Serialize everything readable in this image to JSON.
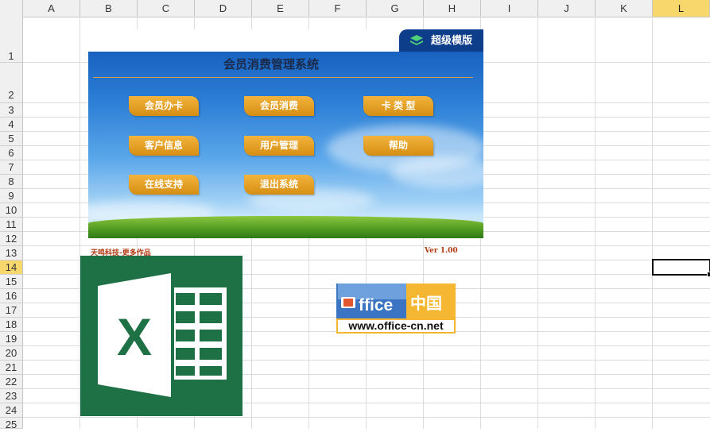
{
  "columns": [
    "A",
    "B",
    "C",
    "D",
    "E",
    "F",
    "G",
    "H",
    "I",
    "J",
    "K",
    "L"
  ],
  "selected_column": "L",
  "rows": [
    "1",
    "2",
    "3",
    "4",
    "5",
    "6",
    "7",
    "8",
    "9",
    "10",
    "11",
    "12",
    "13",
    "14",
    "15",
    "16",
    "17",
    "18",
    "19",
    "20",
    "21",
    "22",
    "23",
    "24",
    "25"
  ],
  "selected_row": "14",
  "panel": {
    "brand": "超级模版",
    "title": "会员消费管理系统",
    "buttons": [
      "会员办卡",
      "会员消费",
      "卡 类 型",
      "客户信息",
      "用户管理",
      "帮助",
      "在线支持",
      "退出系统"
    ]
  },
  "footer": {
    "left": "天鸣科技-更多作品",
    "right": "Ver 1.00"
  },
  "excel_logo": {
    "letter": "X",
    "color": "#1e7145"
  },
  "office_logo": {
    "word1": "ffice",
    "word2": "中国",
    "url": "www.office-cn.net"
  },
  "colors": {
    "accent": "#f8d86d",
    "button": "#e5a020"
  }
}
